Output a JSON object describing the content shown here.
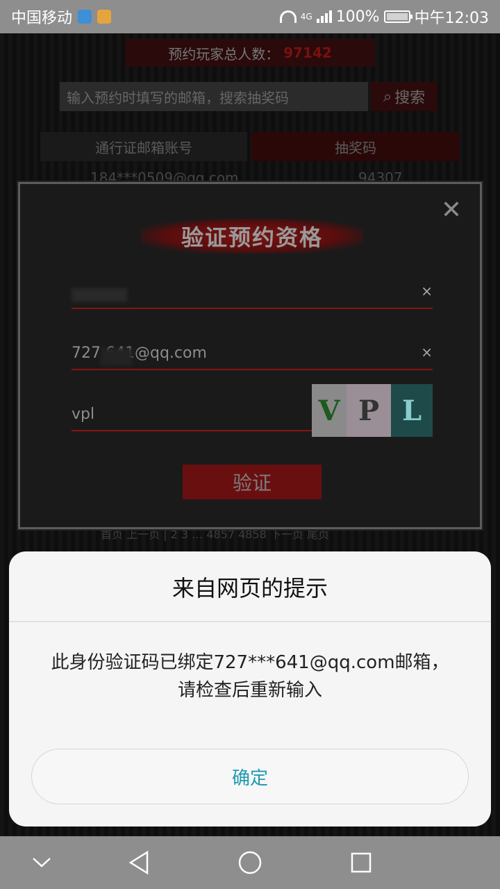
{
  "status_bar": {
    "carrier": "中国移动",
    "network": "4G",
    "battery": "100%",
    "time": "中午12:03"
  },
  "background_page": {
    "reserve_label": "预约玩家总人数：",
    "reserve_count": "97142",
    "search_placeholder": "输入预约时填写的邮箱，搜索抽奖码",
    "search_button": "搜索",
    "columns": [
      "通行证邮箱账号",
      "抽奖码"
    ],
    "row": {
      "email": "184***0509@qq.com",
      "code": "94307"
    },
    "pager": "首页  上一页  |  2  3  …  4857  4858  下一页  尾页"
  },
  "verify_modal": {
    "title": "验证预约资格",
    "close": "✕",
    "field_id_value": "",
    "field_email_value": "727      641@qq.com",
    "field_code_value": "vpl",
    "clear": "×",
    "captcha": [
      "V",
      "P",
      "L"
    ],
    "button": "验证"
  },
  "dialog": {
    "title": "来自网页的提示",
    "message_line1": "此身份验证码已绑定727***641@qq.com邮箱，",
    "message_line2": "请检查后重新输入",
    "ok_button": "确定"
  },
  "nav_bar": {
    "icons": [
      "chevron-down-icon",
      "back-icon",
      "home-icon",
      "recents-icon"
    ]
  },
  "colors": {
    "accent": "#1f9ab0",
    "modal_red": "#8a1414",
    "status_bar": "#8e8e8e"
  }
}
